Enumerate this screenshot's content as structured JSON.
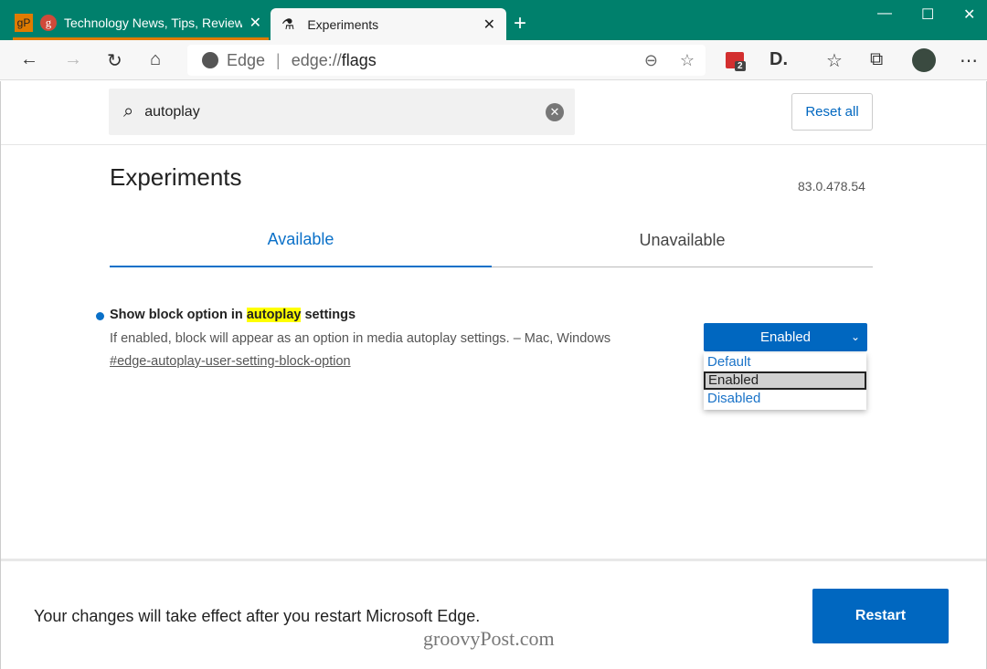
{
  "browser": {
    "tabs": [
      {
        "label": "Technology News, Tips, Reviews,",
        "favicon": "gP"
      },
      {
        "label": "Experiments",
        "icon": "flask-icon"
      }
    ],
    "address": {
      "brand": "Edge",
      "url_prefix": "edge://",
      "url_host": "flags"
    },
    "extension_badge": "2"
  },
  "search": {
    "value": "autoplay"
  },
  "reset_label": "Reset all",
  "title": "Experiments",
  "version": "83.0.478.54",
  "tabs": {
    "available": "Available",
    "unavailable": "Unavailable"
  },
  "experiment": {
    "name_before": "Show block option in ",
    "name_highlight": "autoplay",
    "name_after": " settings",
    "description": "If enabled, block will appear as an option in media autoplay settings. – Mac, Windows",
    "link": "#edge-autoplay-user-setting-block-option",
    "selected": "Enabled",
    "options": [
      "Default",
      "Enabled",
      "Disabled"
    ]
  },
  "footer": {
    "message": "Your changes will take effect after you restart Microsoft Edge.",
    "restart_label": "Restart"
  },
  "watermark": "groovyPost.com",
  "colors": {
    "titlebar": "#00806c",
    "accent": "#0067c0",
    "highlight": "#ffff00"
  }
}
